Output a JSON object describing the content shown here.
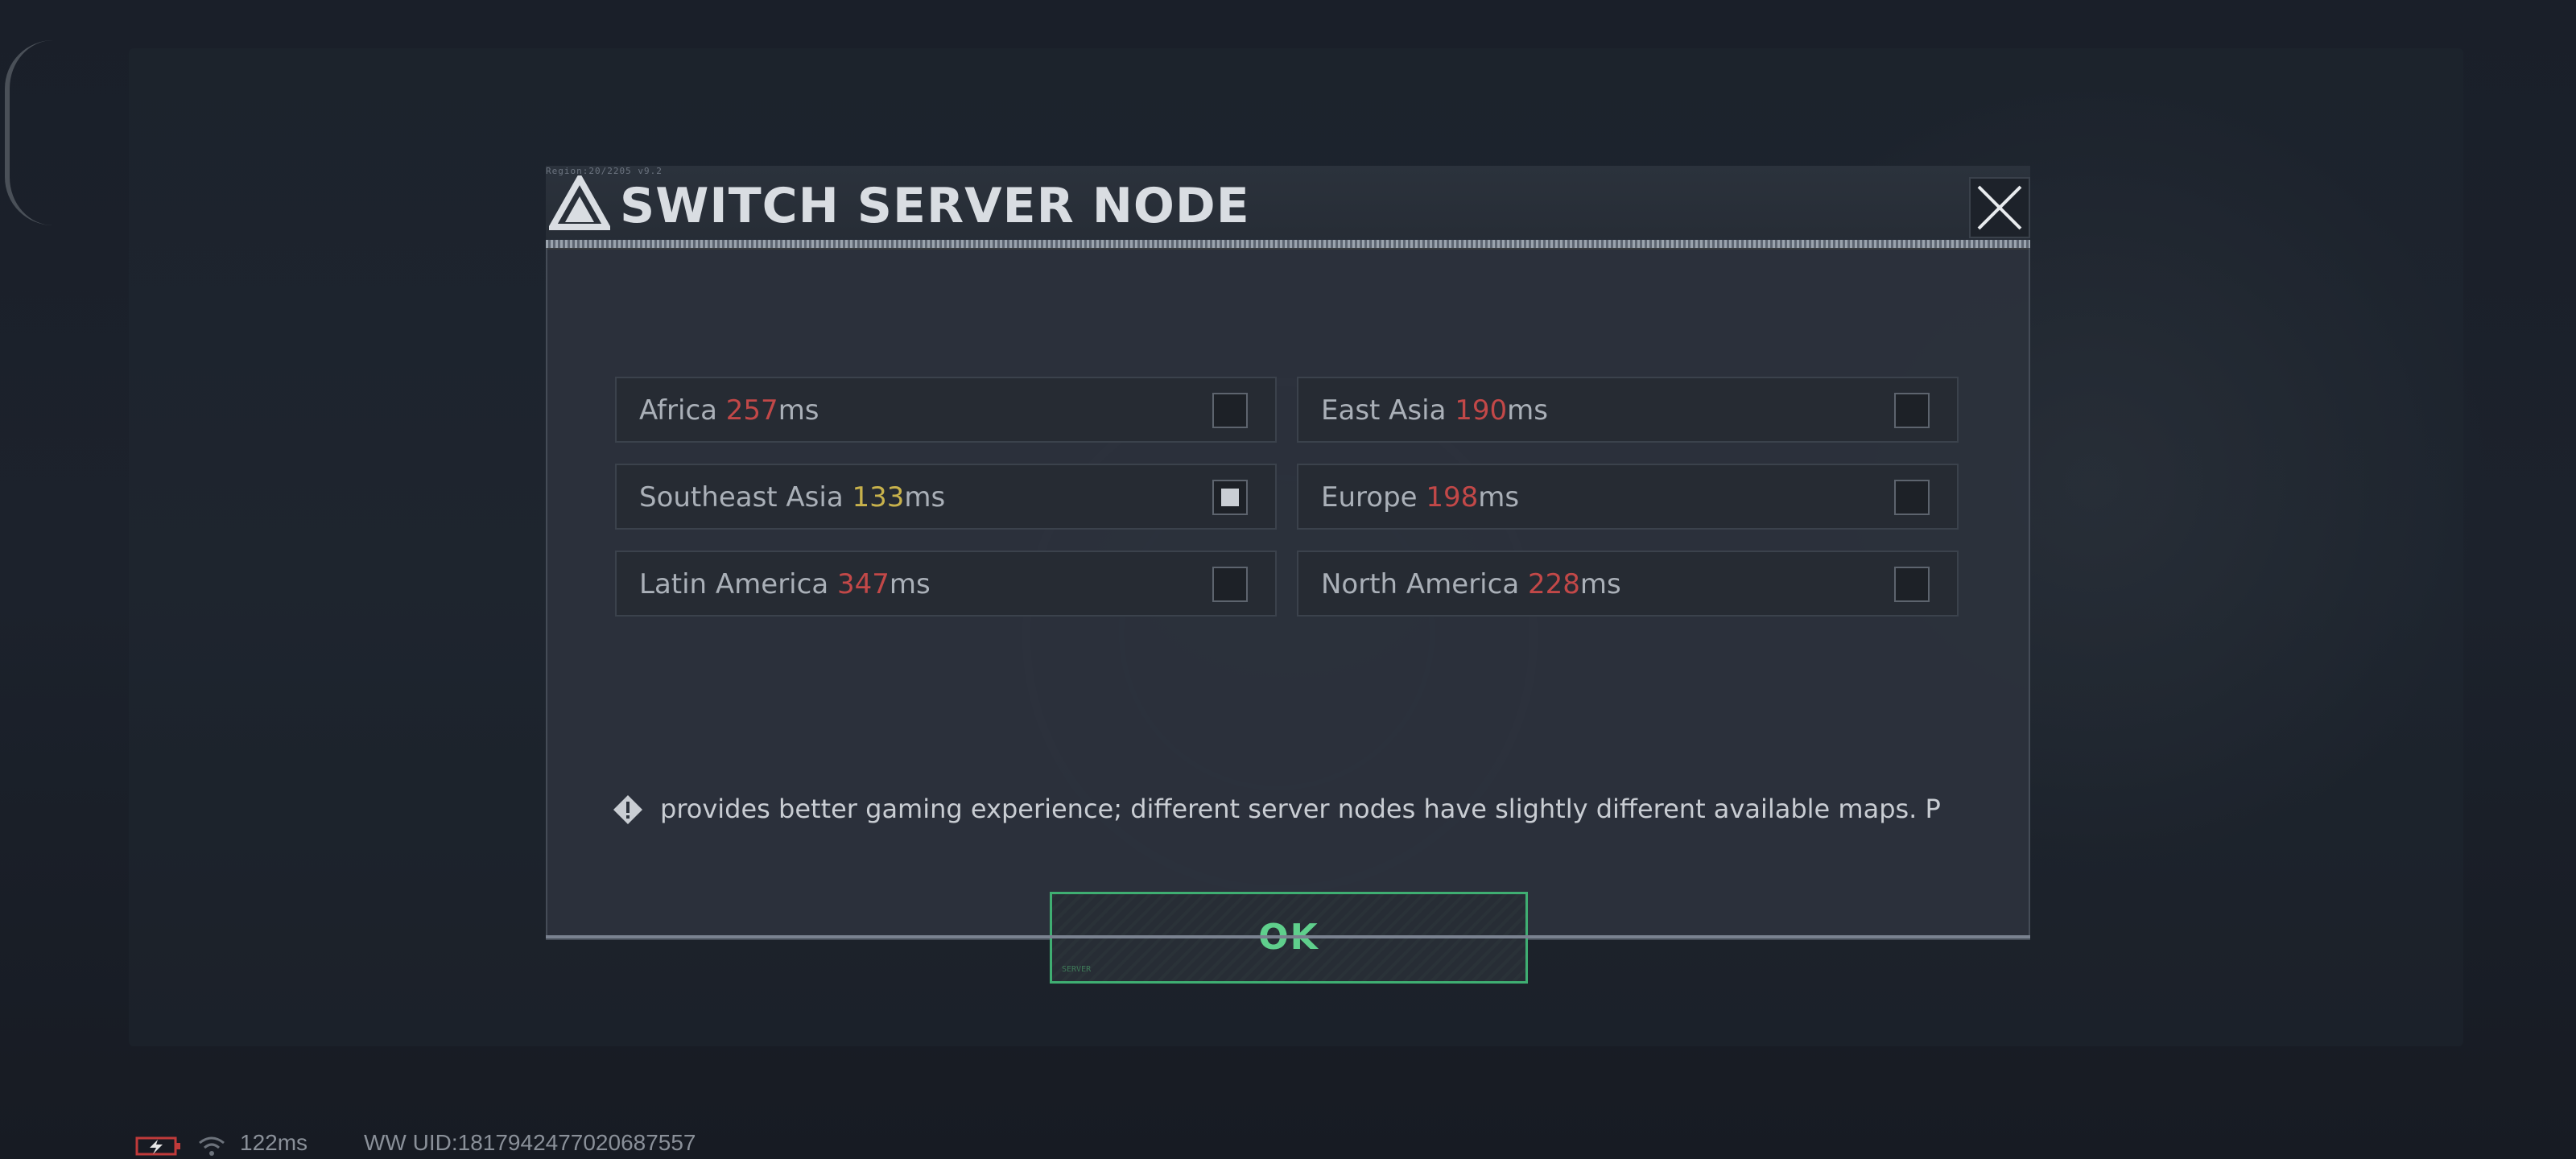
{
  "dialog": {
    "title": "SWITCH SERVER NODE",
    "header_tag": "Region:20/2205 v9.2"
  },
  "servers": [
    {
      "name": "Africa ",
      "latency": "257",
      "unit": "ms",
      "latency_color": "red",
      "selected": false
    },
    {
      "name": "East Asia ",
      "latency": "190",
      "unit": "ms",
      "latency_color": "red",
      "selected": false
    },
    {
      "name": "Southeast Asia ",
      "latency": "133",
      "unit": "ms",
      "latency_color": "yellow",
      "selected": true
    },
    {
      "name": "Europe ",
      "latency": "198",
      "unit": "ms",
      "latency_color": "red",
      "selected": false
    },
    {
      "name": "Latin America ",
      "latency": "347",
      "unit": "ms",
      "latency_color": "red",
      "selected": false
    },
    {
      "name": "North America ",
      "latency": "228",
      "unit": "ms",
      "latency_color": "red",
      "selected": false
    }
  ],
  "notice": {
    "text": "provides better gaming experience; different server nodes have slightly different available maps. P"
  },
  "ok_button": {
    "label": "OK",
    "tag": "SERVER"
  },
  "status_bar": {
    "ping": "122ms",
    "uid": "WW UID:1817942477020687557"
  },
  "colors": {
    "accent_green": "#3fae72",
    "latency_red": "#c24848",
    "latency_yellow": "#c8b24c",
    "gold_rule": "#c9a54a"
  },
  "icons": [
    "triangle-logo-icon",
    "close-icon",
    "warning-diamond-icon",
    "battery-charging-icon",
    "wifi-icon"
  ]
}
